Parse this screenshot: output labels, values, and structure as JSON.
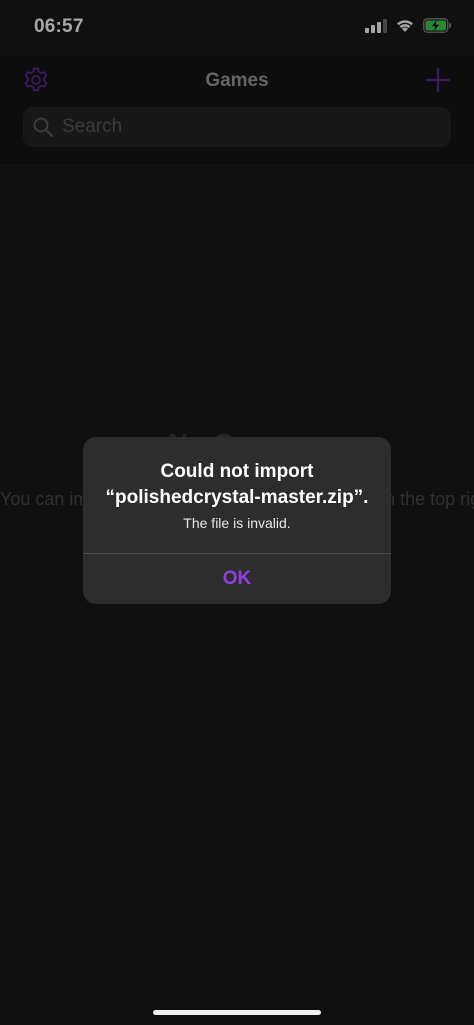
{
  "status_bar": {
    "time": "06:57"
  },
  "nav": {
    "title": "Games",
    "settings_icon": "gear-icon",
    "add_icon": "plus-icon",
    "accent_color": "#5b2d90"
  },
  "search": {
    "placeholder": "Search",
    "value": ""
  },
  "empty_state": {
    "title": "No Games",
    "message": "You can import games by pressing the + button in the top right."
  },
  "alert": {
    "title_line1": "Could not import",
    "title_line2": "“polishedcrystal-master.zip”.",
    "message": "The file is invalid.",
    "ok_label": "OK",
    "button_color": "#8f3fe0"
  }
}
